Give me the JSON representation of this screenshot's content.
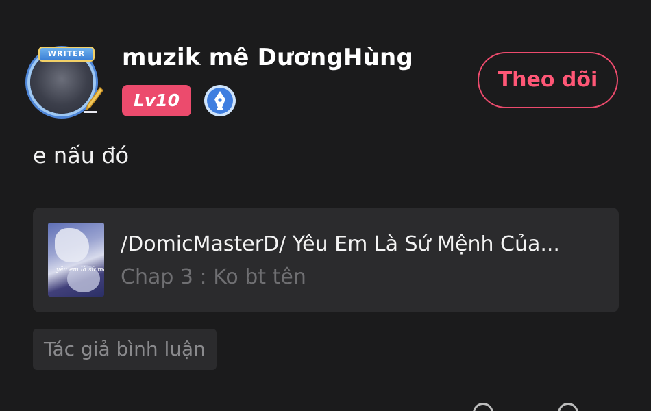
{
  "comment": {
    "author": {
      "name": "muzik mê DươngHùng",
      "avatar_frame_label": "WRITER",
      "level_badge": "Lv10",
      "writer_badge_icon": "pen-nib-icon"
    },
    "follow_button_label": "Theo dõi",
    "text": "e nấu đó",
    "story_card": {
      "title": "/DomicMasterD/ Yêu Em Là Sứ Mệnh Của...",
      "chapter": "Chap 3 : Ko bt tên",
      "cover_caption": "yêu em là sứ mệnh"
    },
    "author_tag": "Tác giả bình luận"
  },
  "colors": {
    "background": "#1b1b1c",
    "accent": "#ec4b6d",
    "card_background": "#2b2b2d",
    "muted_text": "#6f6f72"
  }
}
